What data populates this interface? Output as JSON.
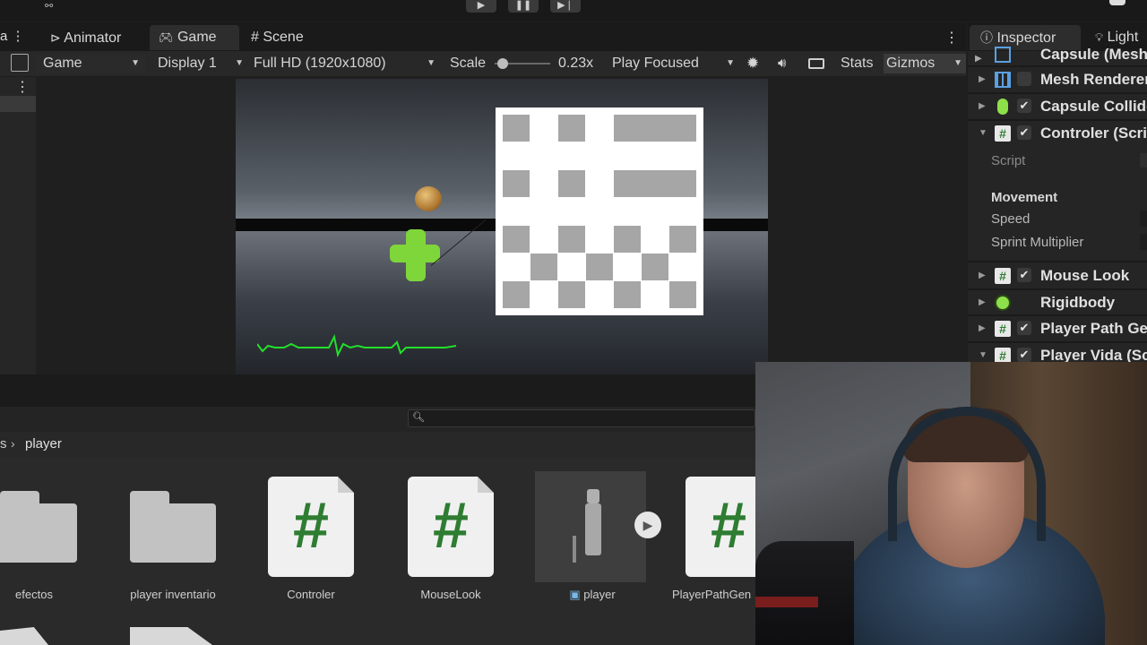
{
  "toolbar": {
    "play_icon": "play-icon",
    "pause_icon": "pause-icon",
    "step_icon": "step-icon"
  },
  "game_tabs": [
    {
      "label": "Animator",
      "icon": "animator-icon"
    },
    {
      "label": "Game",
      "icon": "gamepad-icon",
      "active": true
    },
    {
      "label": "Scene",
      "icon": "grid-icon"
    }
  ],
  "game_toolbar": {
    "view_select": "Game",
    "display_select": "Display 1",
    "resolution_select": "Full HD (1920x1080)",
    "scale_label": "Scale",
    "scale_value": "0.23x",
    "scale_level": 0.05,
    "play_mode_select": "Play Focused",
    "stats_label": "Stats",
    "gizmos_label": "Gizmos"
  },
  "inspector": {
    "tabs": [
      {
        "label": "Inspector",
        "icon": "info-icon",
        "active": true
      },
      {
        "label": "Light",
        "icon": "light-icon"
      }
    ],
    "components": [
      {
        "label": "Capsule (Mesh",
        "icon": "mesh-filter-icon",
        "checkbox": false,
        "checked": false
      },
      {
        "label": "Mesh Renderer",
        "icon": "mesh-renderer-icon",
        "checkbox": true,
        "checked": false
      },
      {
        "label": "Capsule Collide",
        "icon": "capsule-collider-icon",
        "checkbox": true,
        "checked": true
      },
      {
        "label": "Controler (Scrip",
        "icon": "script-icon",
        "checkbox": true,
        "checked": true,
        "expanded": true
      }
    ],
    "controler_props": {
      "script_label": "Script",
      "movement_header": "Movement",
      "speed_label": "Speed",
      "sprint_label": "Sprint Multiplier"
    },
    "more_components": [
      {
        "label": "Mouse Look",
        "icon": "script-icon",
        "checkbox": true,
        "checked": true
      },
      {
        "label": "Rigidbody",
        "icon": "rigidbody-icon",
        "checkbox": false,
        "checked": false
      },
      {
        "label": "Player Path Ger",
        "icon": "script-icon",
        "checkbox": true,
        "checked": true
      },
      {
        "label": "Player Vida (Sc",
        "icon": "script-icon",
        "checkbox": true,
        "checked": true
      }
    ]
  },
  "project": {
    "search_placeholder": "",
    "breadcrumb": {
      "prefix": "s",
      "current": "player"
    },
    "assets": [
      {
        "label": "efectos",
        "type": "folder"
      },
      {
        "label": "player inventario",
        "type": "folder"
      },
      {
        "label": "Controler",
        "type": "script"
      },
      {
        "label": "MouseLook",
        "type": "script"
      },
      {
        "label": "player",
        "type": "prefab"
      },
      {
        "label": "PlayerPathGen",
        "type": "script"
      }
    ]
  },
  "colors": {
    "script_hash": "#2e7d32",
    "heartbeat": "#22e02a",
    "cross": "#7fd63a"
  }
}
